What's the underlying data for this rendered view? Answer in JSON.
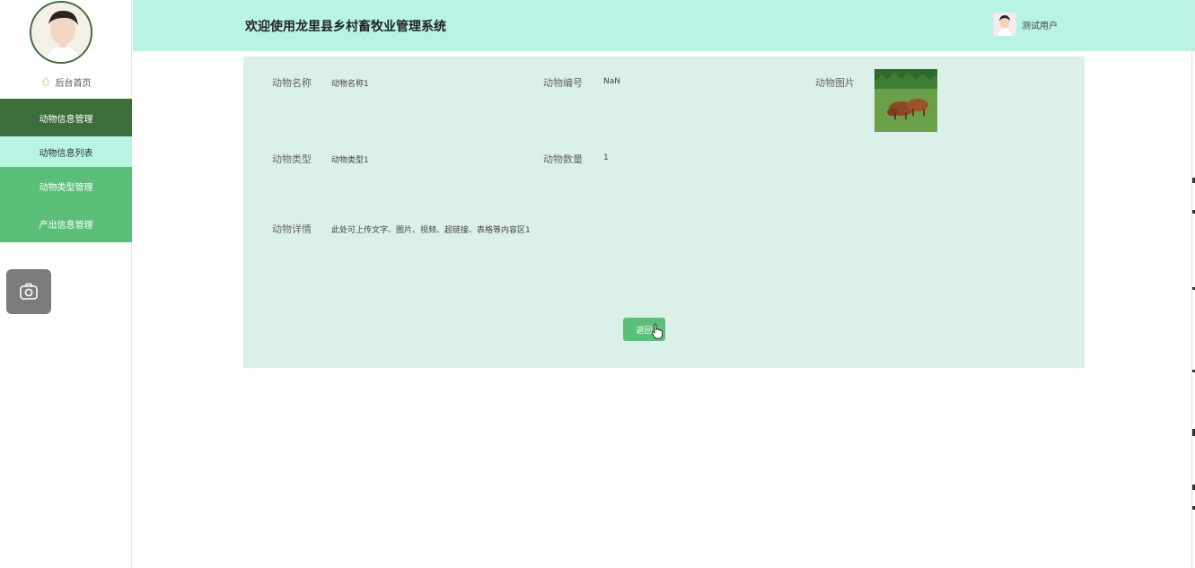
{
  "sidebar": {
    "home_label": "后台首页",
    "menu": [
      {
        "label": "动物信息管理",
        "type": "header"
      },
      {
        "label": "动物信息列表",
        "type": "active"
      },
      {
        "label": "动物类型管理",
        "type": "normal"
      },
      {
        "label": "产出信息管理",
        "type": "normal"
      }
    ]
  },
  "header": {
    "title": "欢迎使用龙里县乡村畜牧业管理系统",
    "username": "测试用户"
  },
  "detail": {
    "name_label": "动物名称",
    "name_value": "动物名称1",
    "number_label": "动物编号",
    "number_value": "NaN",
    "image_label": "动物图片",
    "type_label": "动物类型",
    "type_value": "动物类型1",
    "count_label": "动物数量",
    "count_value": "1",
    "detail_label": "动物详情",
    "detail_value": "此处可上传文字、图片、视频、超链接、表格等内容区1",
    "back_label": "返回"
  },
  "colors": {
    "header_bg": "#b7f4e3",
    "panel_bg": "#dcf0ea",
    "menu_header": "#3b6e3b",
    "menu_item": "#5bbf7a",
    "button": "#5bbf7a"
  }
}
